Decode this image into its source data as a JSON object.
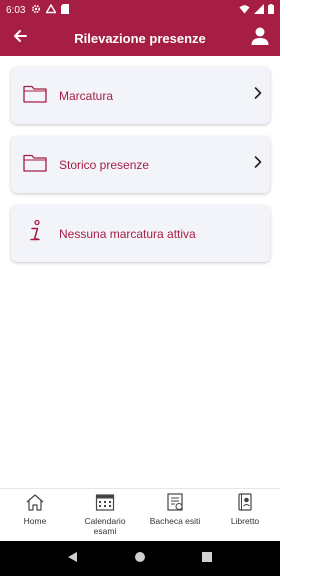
{
  "status_bar": {
    "time": "6:03",
    "icons": [
      "gear-icon",
      "drive-icon",
      "sd-card-icon",
      "wifi-icon",
      "signal-icon",
      "battery-icon"
    ]
  },
  "app_bar": {
    "title": "Rilevazione presenze",
    "back_icon": "arrow-left-icon",
    "profile_icon": "person-icon"
  },
  "cards": [
    {
      "label": "Marcatura",
      "icon": "folder-icon",
      "has_chevron": true
    },
    {
      "label": "Storico presenze",
      "icon": "folder-icon",
      "has_chevron": true
    },
    {
      "label": "Nessuna marcatura attiva",
      "icon": "info-icon",
      "has_chevron": false
    }
  ],
  "bottom_nav": [
    {
      "label": "Home",
      "icon": "home-icon"
    },
    {
      "label": "Calendario esami",
      "icon": "calendar-icon"
    },
    {
      "label": "Bacheca esiti",
      "icon": "board-icon"
    },
    {
      "label": "Libretto",
      "icon": "booklet-icon"
    }
  ],
  "colors": {
    "primary": "#a61e44",
    "card_background": "#f3f4f9",
    "system_nav": "#000000"
  }
}
